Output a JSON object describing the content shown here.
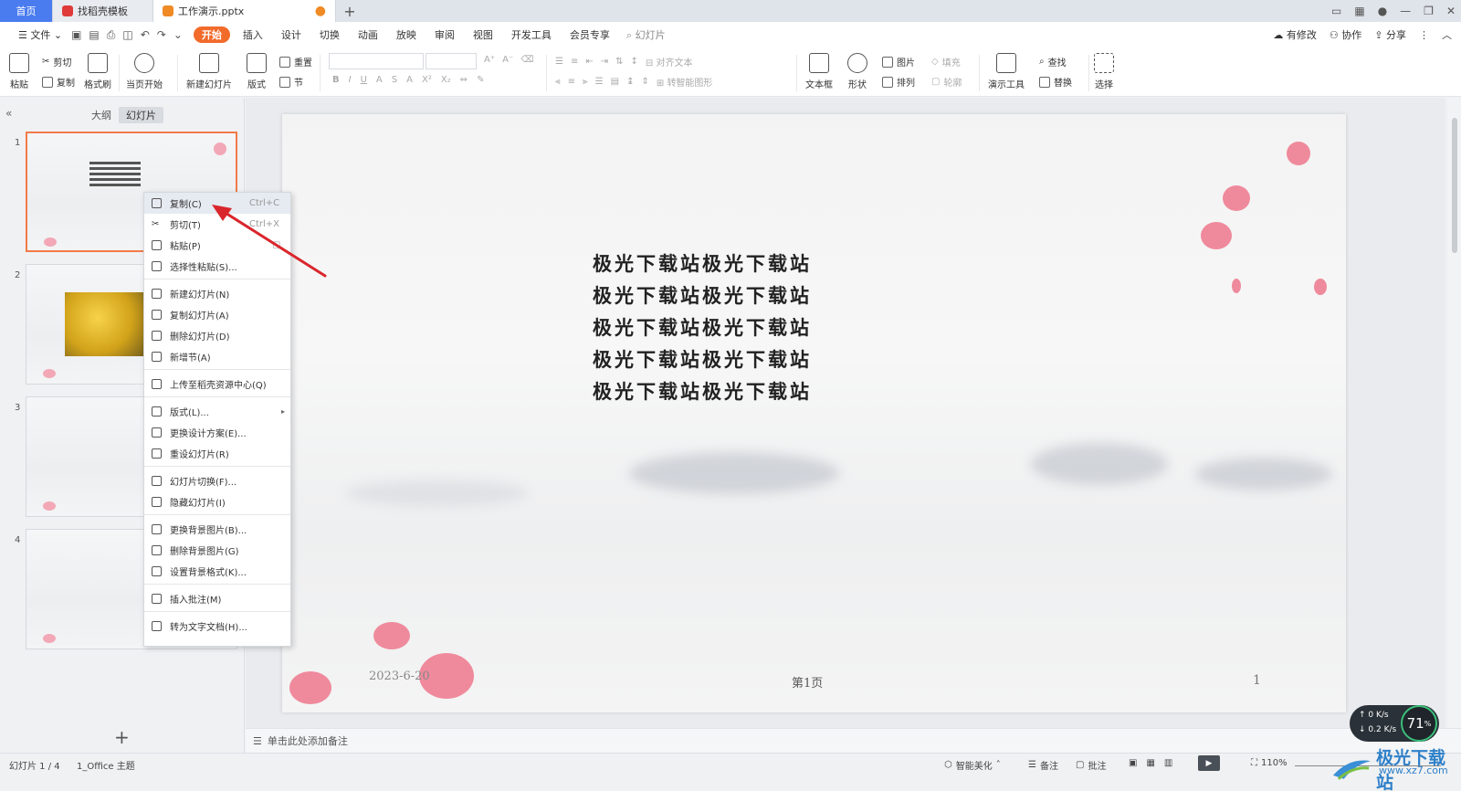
{
  "tabs": {
    "home": "首页",
    "template": "找稻壳模板",
    "doc": "工作演示.pptx"
  },
  "menu": {
    "file": "文件",
    "items": [
      "开始",
      "插入",
      "设计",
      "切换",
      "动画",
      "放映",
      "审阅",
      "视图",
      "开发工具",
      "会员专享"
    ],
    "search": "幻灯片",
    "right": [
      "有修改",
      "协作",
      "分享"
    ]
  },
  "ribbon": {
    "paste": "粘贴",
    "cut": "剪切",
    "copy": "复制",
    "format_painter": "格式刷",
    "from_current": "当页开始",
    "new_slide": "新建幻灯片",
    "layout": "版式",
    "reset": "重置",
    "section": "节",
    "align_text": "对齐文本",
    "smart_shape": "转智能图形",
    "textbox": "文本框",
    "shape": "形状",
    "picture": "图片",
    "fill": "填充",
    "arrange": "排列",
    "outline": "轮廓",
    "present_tools": "演示工具",
    "find": "查找",
    "replace": "替换",
    "select": "选择"
  },
  "panel": {
    "outline_tab": "大纲",
    "slides_tab": "幻灯片",
    "slide_numbers": [
      "1",
      "2",
      "3",
      "4"
    ]
  },
  "context_menu": [
    {
      "label": "复制(C)",
      "shortcut": "Ctrl+C",
      "highlight": true
    },
    {
      "label": "剪切(T)",
      "shortcut": "Ctrl+X"
    },
    {
      "label": "粘贴(P)",
      "shortcut": ""
    },
    {
      "label": "选择性粘贴(S)...",
      "shortcut": ""
    },
    {
      "label": "新建幻灯片(N)",
      "shortcut": ""
    },
    {
      "label": "复制幻灯片(A)",
      "shortcut": ""
    },
    {
      "label": "删除幻灯片(D)",
      "shortcut": ""
    },
    {
      "label": "新增节(A)",
      "shortcut": ""
    },
    {
      "label": "上传至稻壳资源中心(Q)",
      "shortcut": ""
    },
    {
      "label": "版式(L)...",
      "shortcut": ""
    },
    {
      "label": "更换设计方案(E)...",
      "shortcut": ""
    },
    {
      "label": "重设幻灯片(R)",
      "shortcut": ""
    },
    {
      "label": "幻灯片切换(F)...",
      "shortcut": ""
    },
    {
      "label": "隐藏幻灯片(I)",
      "shortcut": ""
    },
    {
      "label": "更换背景图片(B)...",
      "shortcut": ""
    },
    {
      "label": "删除背景图片(G)",
      "shortcut": ""
    },
    {
      "label": "设置背景格式(K)...",
      "shortcut": ""
    },
    {
      "label": "插入批注(M)",
      "shortcut": ""
    },
    {
      "label": "转为文字文档(H)...",
      "shortcut": ""
    }
  ],
  "slide": {
    "lines": [
      "极光下载站极光下载站",
      "极光下载站极光下载站",
      "极光下载站极光下载站",
      "极光下载站极光下载站",
      "极光下载站极光下载站"
    ],
    "date": "2023-6-20",
    "page_label": "第1页",
    "page_number": "1"
  },
  "notes": {
    "placeholder": "单击此处添加备注"
  },
  "status": {
    "slide_counter": "幻灯片 1 / 4",
    "theme": "1_Office 主题",
    "smart_beautify": "智能美化",
    "notes": "备注",
    "comments": "批注",
    "zoom": "110%"
  },
  "speed": {
    "up": "0 K/s",
    "down": "0.2 K/s",
    "percent": "71"
  },
  "watermark": {
    "name": "极光下载站",
    "url": "www.xz7.com"
  },
  "colors": {
    "accent": "#f26b2b",
    "tab_home": "#4a7cf0",
    "annotation": "#d9262c"
  }
}
